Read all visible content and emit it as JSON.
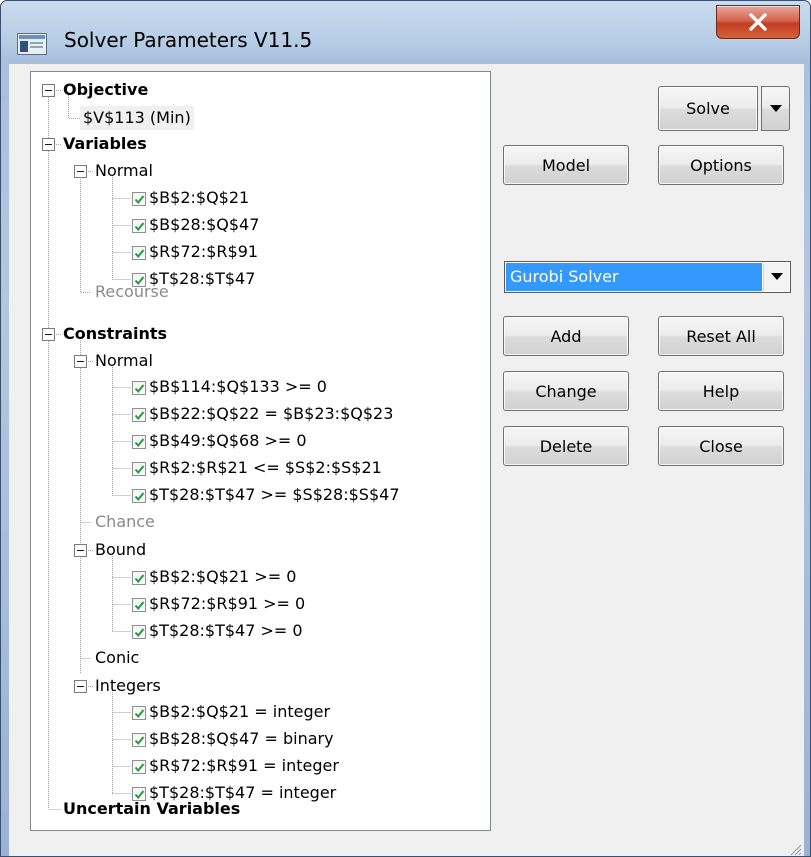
{
  "window": {
    "title": "Solver Parameters V11.5",
    "close_icon": "close-x-icon"
  },
  "tree": {
    "objective_label": "Objective",
    "objective_value": "$V$113 (Min)",
    "variables_label": "Variables",
    "variables_normal_label": "Normal",
    "variables": [
      "$B$2:$Q$21",
      "$B$28:$Q$47",
      "$R$72:$R$91",
      "$T$28:$T$47"
    ],
    "recourse_label": "Recourse",
    "constraints_label": "Constraints",
    "constraints_normal_label": "Normal",
    "constraints_normal": [
      "$B$114:$Q$133 >= 0",
      "$B$22:$Q$22 = $B$23:$Q$23",
      "$B$49:$Q$68 >= 0",
      "$R$2:$R$21 <= $S$2:$S$21",
      "$T$28:$T$47 >= $S$28:$S$47"
    ],
    "chance_label": "Chance",
    "bound_label": "Bound",
    "bound": [
      "$B$2:$Q$21 >= 0",
      "$R$72:$R$91 >= 0",
      "$T$28:$T$47 >= 0"
    ],
    "conic_label": "Conic",
    "integers_label": "Integers",
    "integers": [
      "$B$2:$Q$21 = integer",
      "$B$28:$Q$47 = binary",
      "$R$72:$R$91 = integer",
      "$T$28:$T$47 = integer"
    ],
    "uncertain_label": "Uncertain Variables"
  },
  "buttons": {
    "solve": "Solve",
    "model": "Model",
    "options": "Options",
    "add": "Add",
    "reset_all": "Reset All",
    "change": "Change",
    "help": "Help",
    "delete": "Delete",
    "close": "Close"
  },
  "solver_select": {
    "value": "Gurobi Solver"
  },
  "colors": {
    "selection": "#3399ff",
    "close_button": "#c9432a",
    "title_bar": "#b7cde6"
  }
}
